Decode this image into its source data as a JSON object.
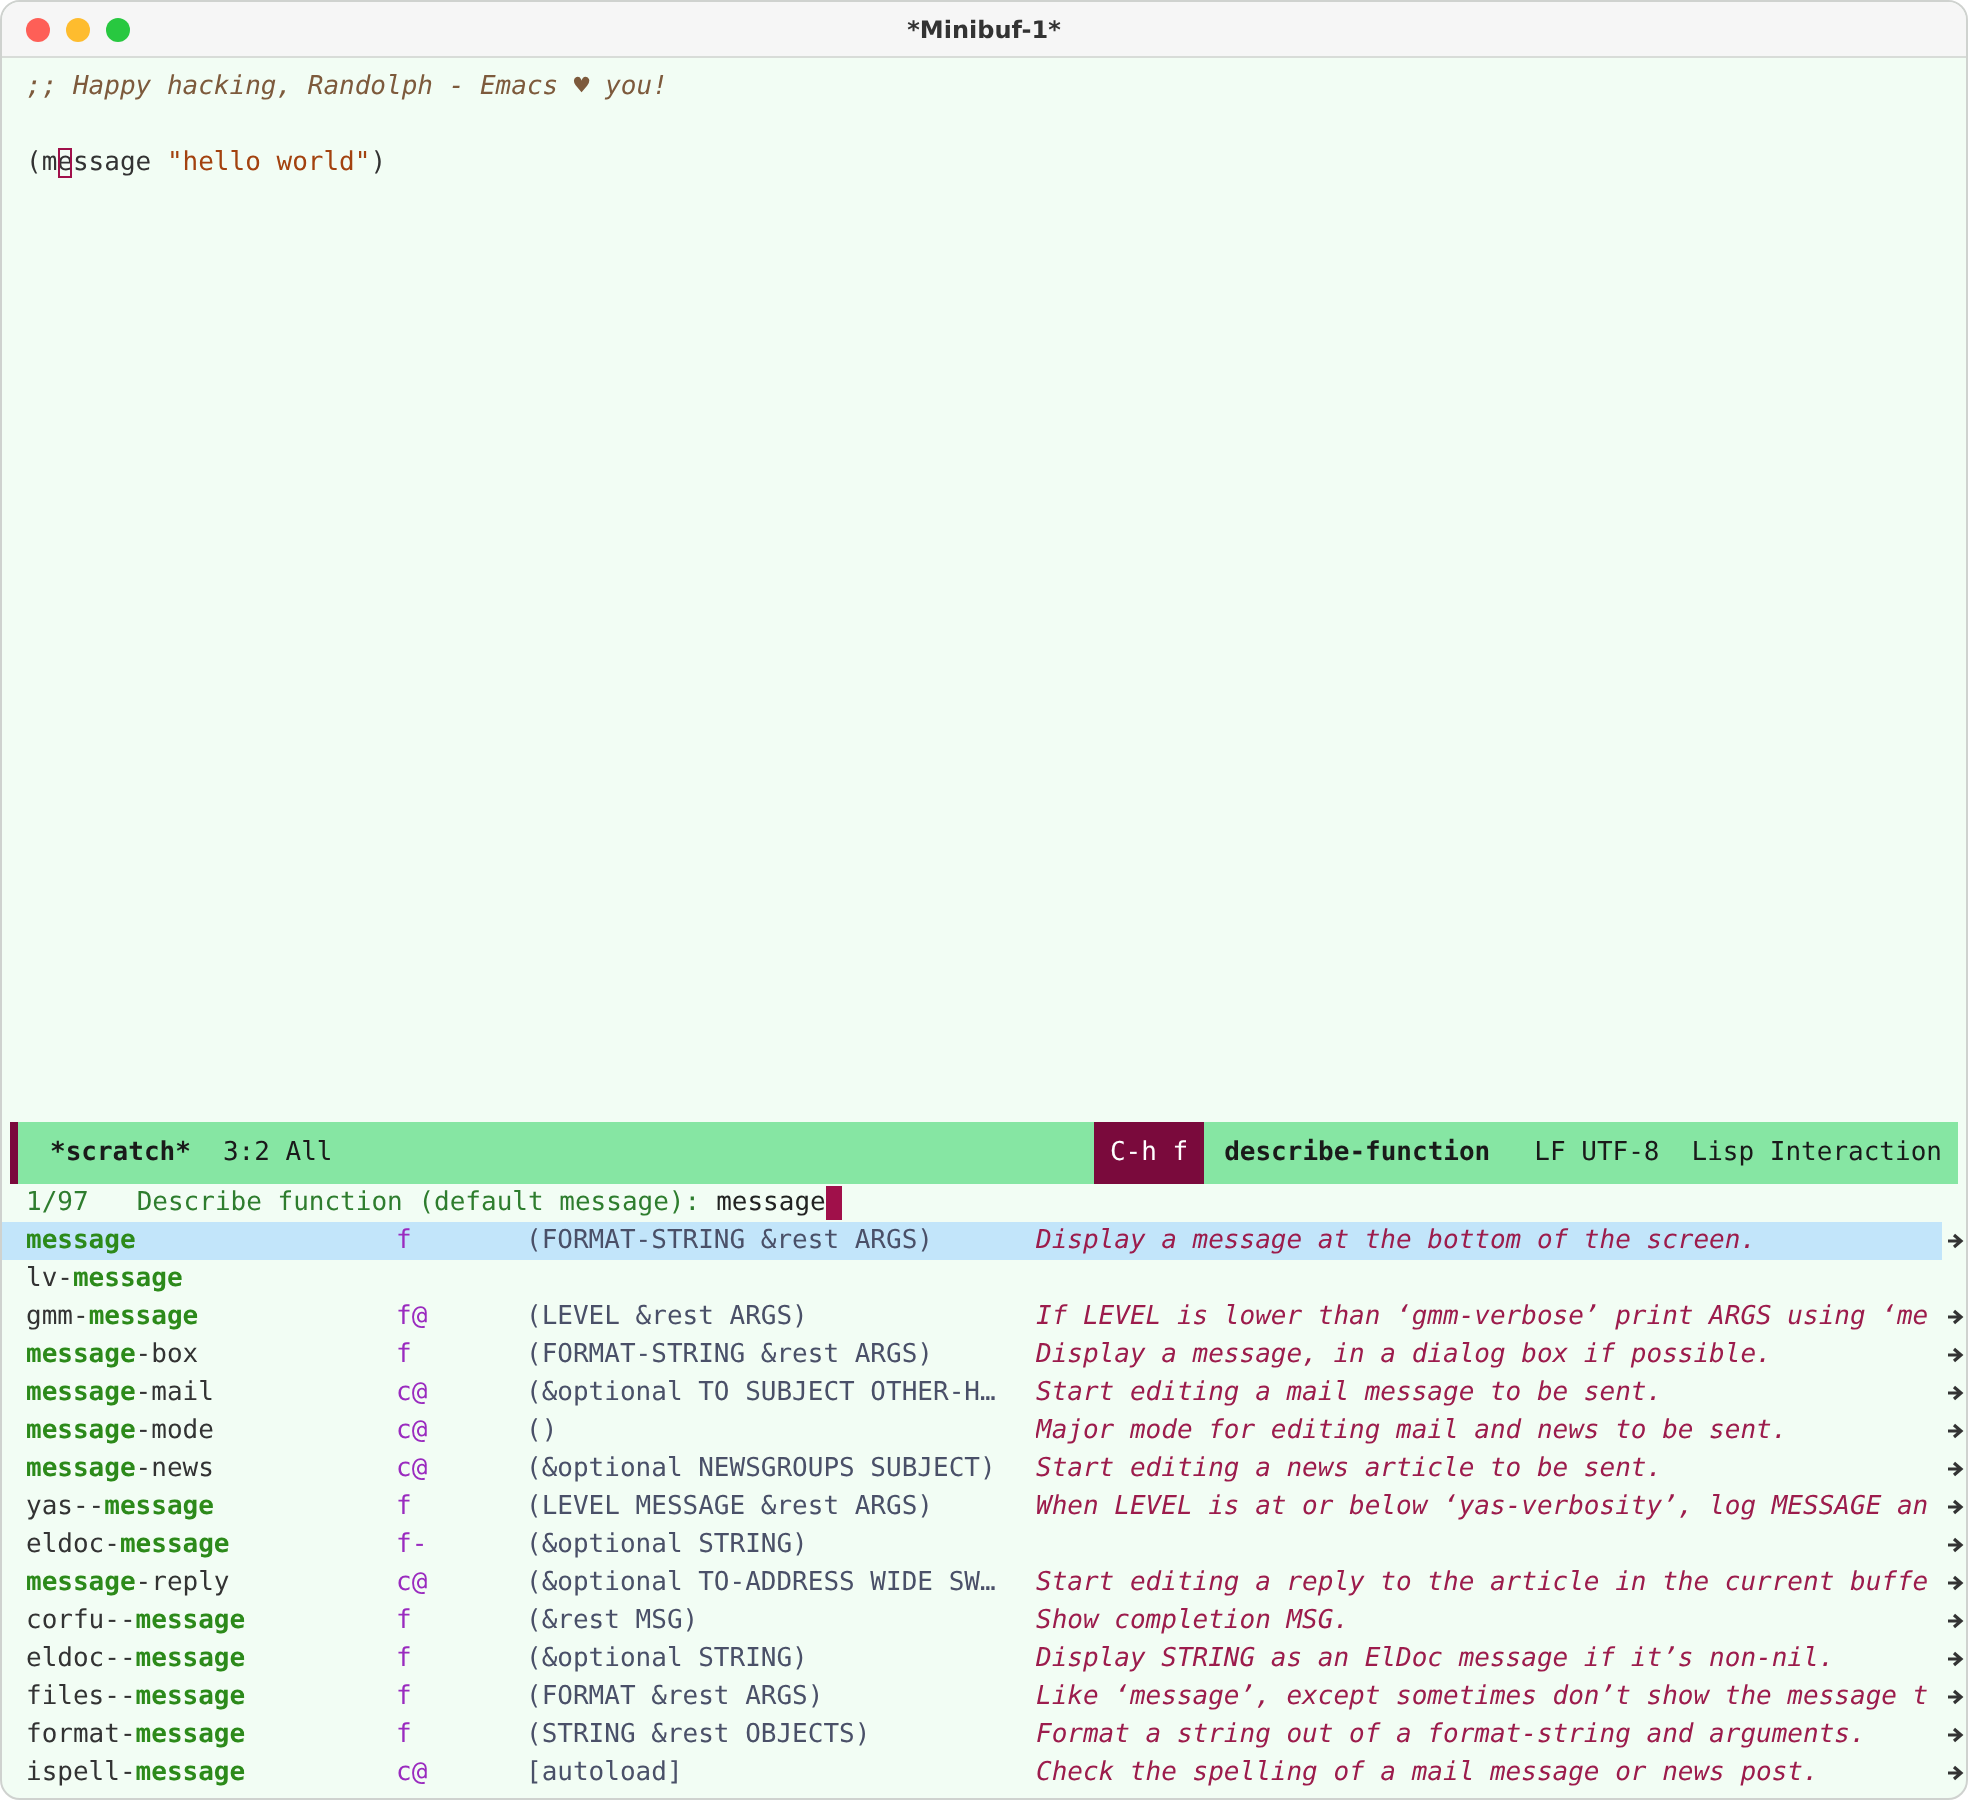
{
  "window": {
    "title": "*Minibuf-1*"
  },
  "buffer": {
    "comment": ";; Happy hacking, Randolph - Emacs ♥ you!",
    "code": {
      "before": "(m",
      "cursor": "e",
      "after": "ssage ",
      "string": "\"hello world\"",
      "close": ")"
    }
  },
  "mode_line": {
    "buffer_name": "*scratch*",
    "position": "3:2 All",
    "keys": "C-h f",
    "command": "describe-function",
    "encoding": "LF UTF-8",
    "mode": "Lisp Interaction"
  },
  "minibuffer": {
    "count": "1/97",
    "prompt": "Describe function (default message):",
    "input": "message"
  },
  "candidates": [
    {
      "match": "message",
      "kind": "f",
      "args": "(FORMAT-STRING &rest ARGS)",
      "doc": "Display a message at the bottom of the screen.",
      "selected": true,
      "truncated": true
    },
    {
      "prefix": "lv-",
      "match": "message",
      "selected": false,
      "truncated": false
    },
    {
      "prefix": "gmm-",
      "match": "message",
      "kind": "f@",
      "args": "(LEVEL &rest ARGS)",
      "doc": "If LEVEL is lower than ‘gmm-verbose’ print ARGS using ‘me",
      "selected": false,
      "truncated": true
    },
    {
      "match": "message",
      "suffix": "-box",
      "kind": "f",
      "args": "(FORMAT-STRING &rest ARGS)",
      "doc": "Display a message, in a dialog box if possible.",
      "selected": false,
      "truncated": true
    },
    {
      "match": "message",
      "suffix": "-mail",
      "kind": "c@",
      "args": "(&optional TO SUBJECT OTHER-H…",
      "doc": "Start editing a mail message to be sent.",
      "selected": false,
      "truncated": true
    },
    {
      "match": "message",
      "suffix": "-mode",
      "kind": "c@",
      "args": "()",
      "doc": "Major mode for editing mail and news to be sent.",
      "selected": false,
      "truncated": true
    },
    {
      "match": "message",
      "suffix": "-news",
      "kind": "c@",
      "args": "(&optional NEWSGROUPS SUBJECT)",
      "doc": "Start editing a news article to be sent.",
      "selected": false,
      "truncated": true
    },
    {
      "prefix": "yas--",
      "match": "message",
      "kind": "f",
      "args": "(LEVEL MESSAGE &rest ARGS)",
      "doc": "When LEVEL is at or below ‘yas-verbosity’, log MESSAGE an",
      "selected": false,
      "truncated": true
    },
    {
      "prefix": "eldoc-",
      "match": "message",
      "kind": "f-",
      "args": "(&optional STRING)",
      "selected": false,
      "truncated": true
    },
    {
      "match": "message",
      "suffix": "-reply",
      "kind": "c@",
      "args": "(&optional TO-ADDRESS WIDE SW…",
      "doc": "Start editing a reply to the article in the current buffe",
      "selected": false,
      "truncated": true
    },
    {
      "prefix": "corfu--",
      "match": "message",
      "kind": "f",
      "args": "(&rest MSG)",
      "doc": "Show completion MSG.",
      "selected": false,
      "truncated": true
    },
    {
      "prefix": "eldoc--",
      "match": "message",
      "kind": "f",
      "args": "(&optional STRING)",
      "doc": "Display STRING as an ElDoc message if it’s non-nil.",
      "selected": false,
      "truncated": true
    },
    {
      "prefix": "files--",
      "match": "message",
      "kind": "f",
      "args": "(FORMAT &rest ARGS)",
      "doc": "Like ‘message’, except sometimes don’t show the message t",
      "selected": false,
      "truncated": true
    },
    {
      "prefix": "format-",
      "match": "message",
      "kind": "f",
      "args": "(STRING &rest OBJECTS)",
      "doc": "Format a string out of a format-string and arguments.",
      "selected": false,
      "truncated": true
    },
    {
      "prefix": "ispell-",
      "match": "message",
      "kind": "c@",
      "args": "[autoload]",
      "doc": "Check the spelling of a mail message or news post.",
      "selected": false,
      "truncated": true
    }
  ]
}
